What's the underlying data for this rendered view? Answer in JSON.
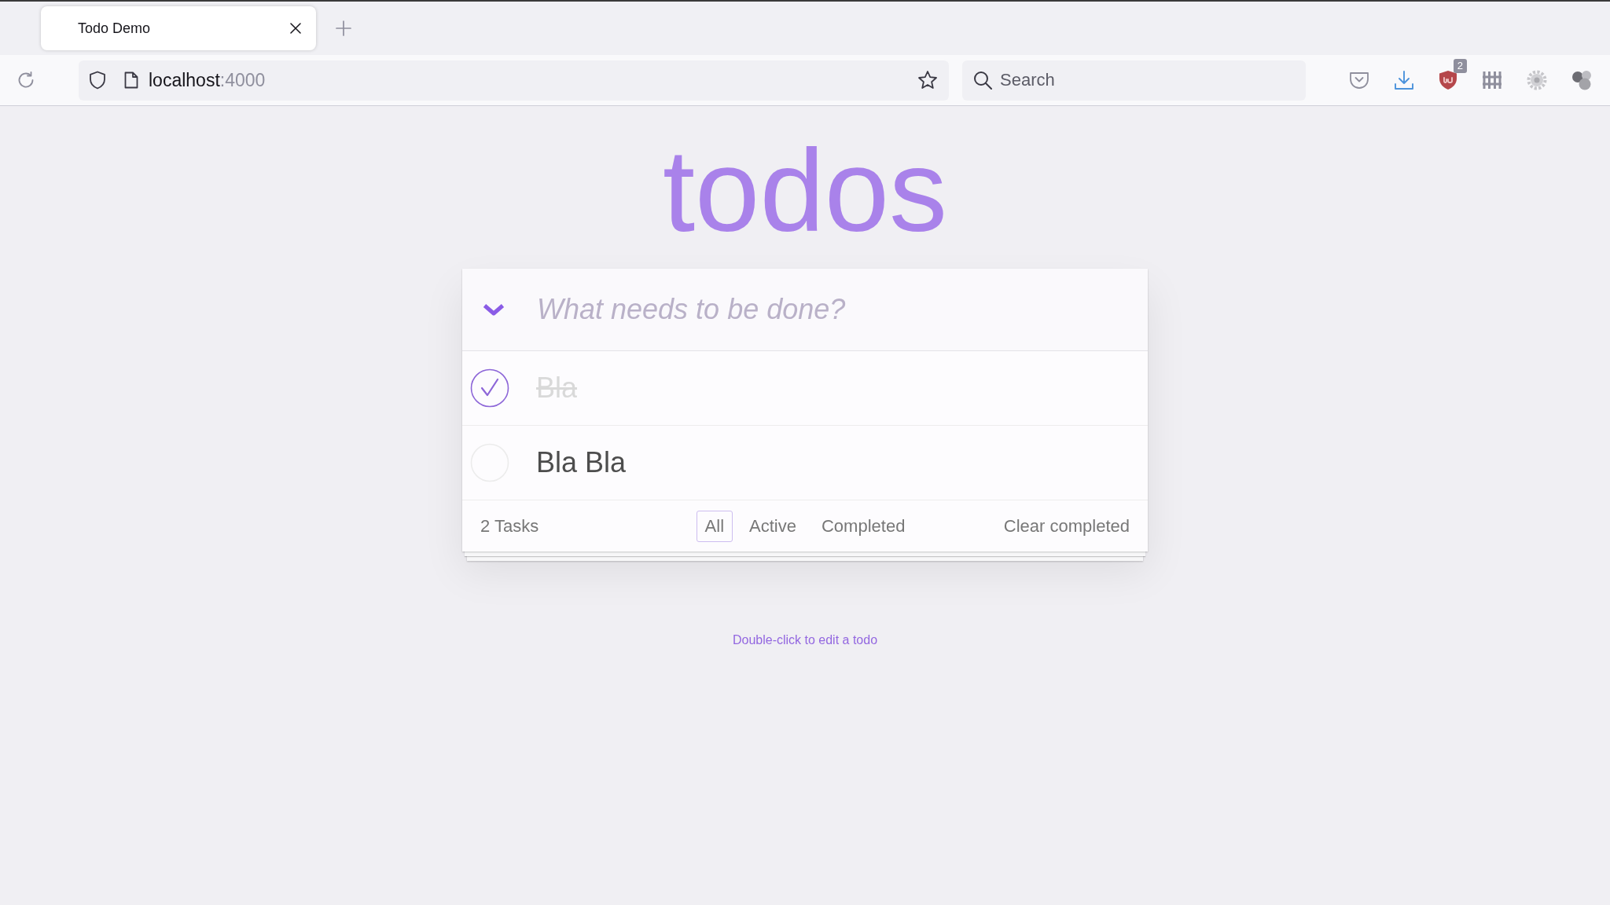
{
  "browser": {
    "tabs": [
      {
        "title": "Todo Demo",
        "selected": true
      }
    ],
    "address_bar": {
      "host": "localhost",
      "port": ":4000"
    },
    "search": {
      "placeholder": "Search"
    },
    "toolbar": {
      "extension_badge": "2"
    }
  },
  "app": {
    "title": "todos",
    "new_todo": {
      "placeholder": "What needs to be done?"
    },
    "todos": [
      {
        "text": "Bla",
        "completed": true
      },
      {
        "text": "Bla Bla",
        "completed": false
      }
    ],
    "footer": {
      "count": "2 Tasks",
      "filters": [
        {
          "label": "All",
          "selected": true
        },
        {
          "label": "Active",
          "selected": false
        },
        {
          "label": "Completed",
          "selected": false
        }
      ],
      "clear_button": "Clear completed"
    },
    "info": "Double-click to edit a todo"
  }
}
